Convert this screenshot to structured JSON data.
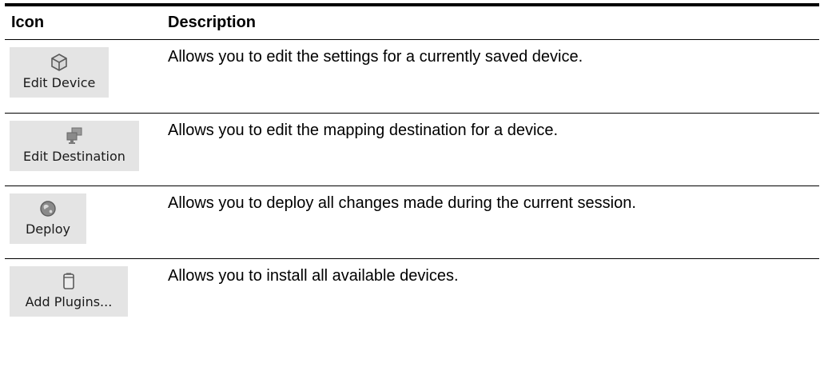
{
  "table": {
    "header": {
      "icon": "Icon",
      "description": "Description"
    },
    "rows": [
      {
        "button_label": "Edit Device",
        "icon": "cube-icon",
        "description": "Allows you to edit the settings for a currently saved device."
      },
      {
        "button_label": "Edit Destination",
        "icon": "computers-icon",
        "description": "Allows you to edit the mapping destination for a device."
      },
      {
        "button_label": "Deploy",
        "icon": "globe-icon",
        "description": "Allows you to deploy all changes made during the current session."
      },
      {
        "button_label": "Add Plugins...",
        "icon": "device-icon",
        "description": "Allows you to install all available devices."
      }
    ]
  },
  "colors": {
    "rule": "#000000",
    "button_background": "#e4e4e4",
    "icon_gray": "#8a8a8a"
  }
}
